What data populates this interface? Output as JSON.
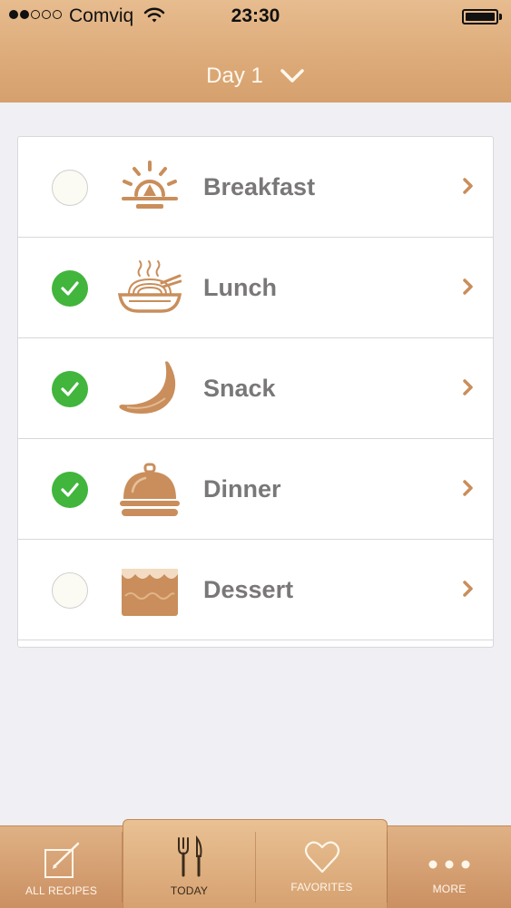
{
  "status_bar": {
    "carrier": "Comviq",
    "time": "23:30",
    "signal_filled": 2,
    "signal_total": 5
  },
  "header": {
    "title": "Day 1"
  },
  "meals": [
    {
      "label": "Breakfast",
      "checked": false,
      "icon": "sunrise-icon"
    },
    {
      "label": "Lunch",
      "checked": true,
      "icon": "noodle-bowl-icon"
    },
    {
      "label": "Snack",
      "checked": true,
      "icon": "banana-icon"
    },
    {
      "label": "Dinner",
      "checked": true,
      "icon": "cloche-icon"
    },
    {
      "label": "Dessert",
      "checked": false,
      "icon": "cake-icon"
    }
  ],
  "tabs": [
    {
      "label": "ALL RECIPES",
      "icon": "edit-icon",
      "active": false
    },
    {
      "label": "TODAY",
      "icon": "fork-knife-icon",
      "active": true
    },
    {
      "label": "FAVORITES",
      "icon": "heart-icon",
      "active": false
    },
    {
      "label": "MORE",
      "icon": "more-dots-icon",
      "active": false
    }
  ],
  "colors": {
    "accent": "#d9a574",
    "icon_brown": "#c98e5b",
    "check_green": "#41b53c",
    "label_gray": "#7a7778"
  }
}
